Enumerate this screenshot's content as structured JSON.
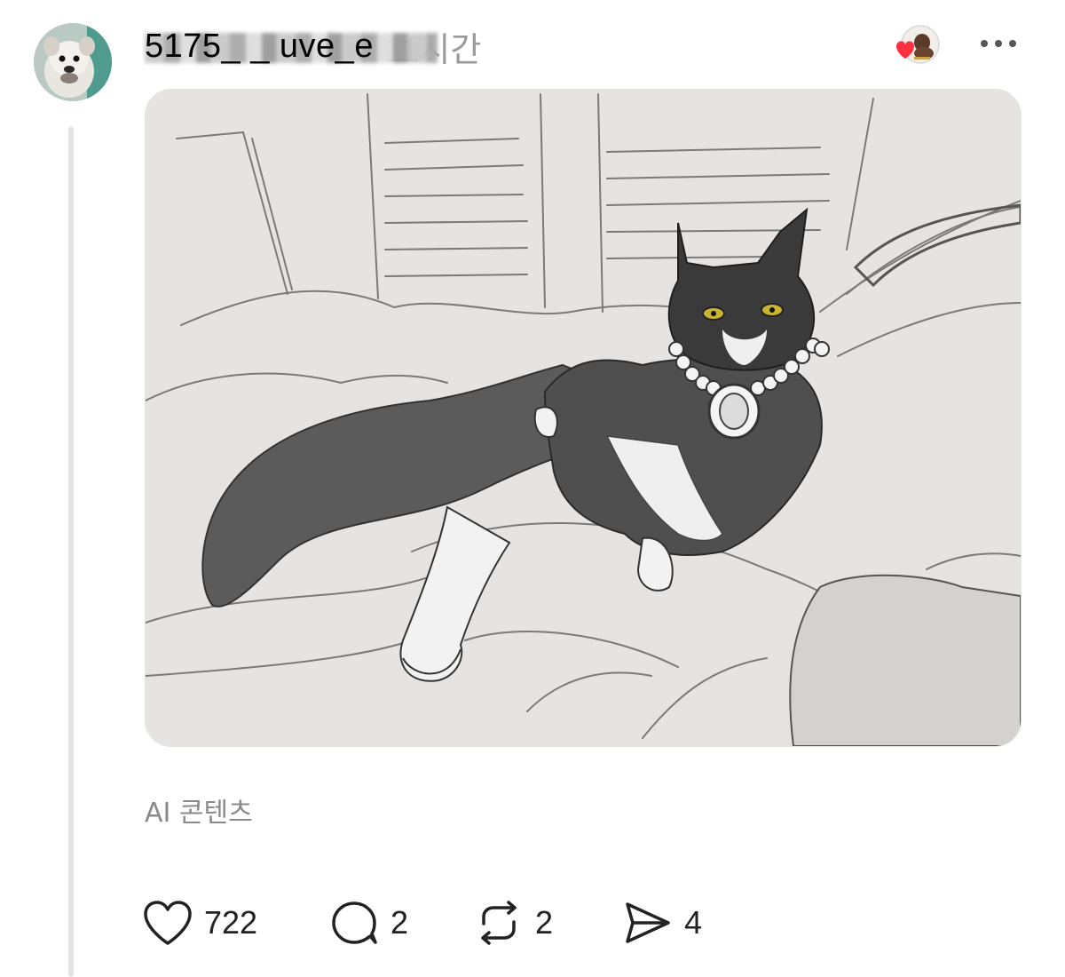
{
  "post": {
    "username_visible": "5175_ _ uve_e",
    "time": "11시간",
    "ai_label": "AI 콘텐츠"
  },
  "actions": {
    "like_count": "722",
    "reply_count": "2",
    "repost_count": "2",
    "share_count": "4"
  },
  "colors": {
    "heart": "#ff3040",
    "muted_text": "#9a9a9a",
    "thread_line": "#e5e5e5"
  }
}
